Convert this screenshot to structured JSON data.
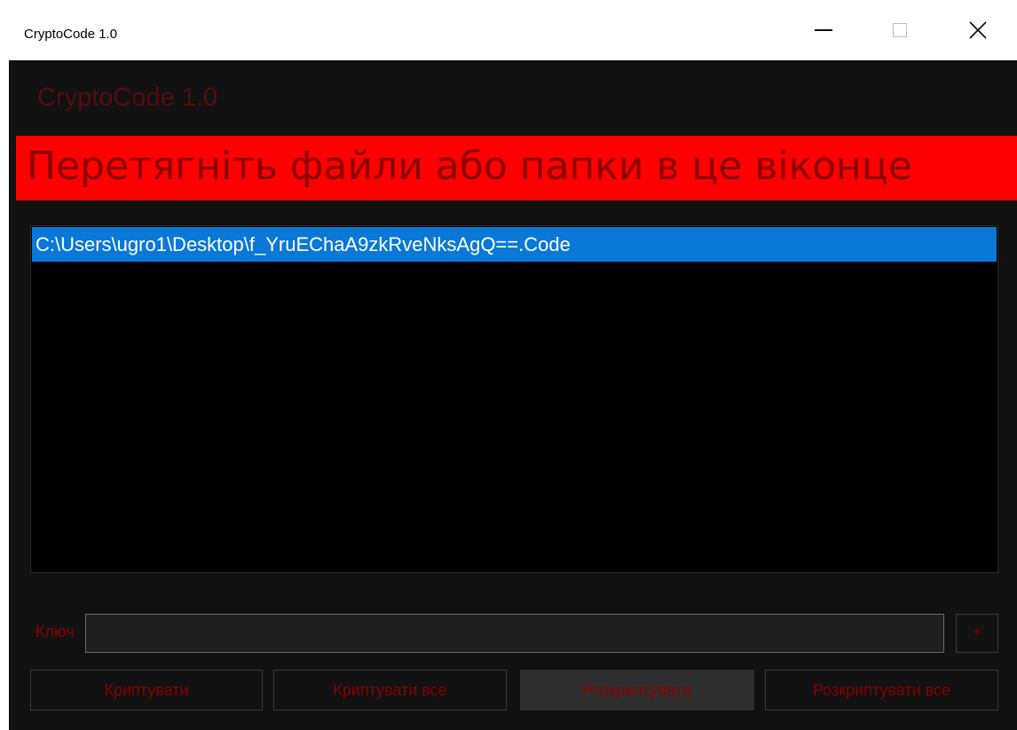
{
  "window": {
    "title": "CryptoCode 1.0",
    "controls": {
      "close_glyph": "✕"
    }
  },
  "app": {
    "heading": "CryptoCode 1.0",
    "banner": "Перетягніть файли або папки в це віконце"
  },
  "file_list": {
    "items": [
      {
        "path": "C:\\Users\\ugro1\\Desktop\\f_YruEChaA9zkRveNksAgQ==.Code",
        "selected": true
      }
    ]
  },
  "key": {
    "label": "Ключ",
    "value": "",
    "toggle_label": "*"
  },
  "buttons": {
    "encrypt": "Криптувати",
    "encrypt_all": "Криптувати все",
    "decrypt": "Розкриптувати",
    "decrypt_all": "Розкриптувати все"
  },
  "colors": {
    "background": "#111111",
    "banner": "#ff0000",
    "accent_text": "#8b0000",
    "selection": "#0a78d7"
  }
}
